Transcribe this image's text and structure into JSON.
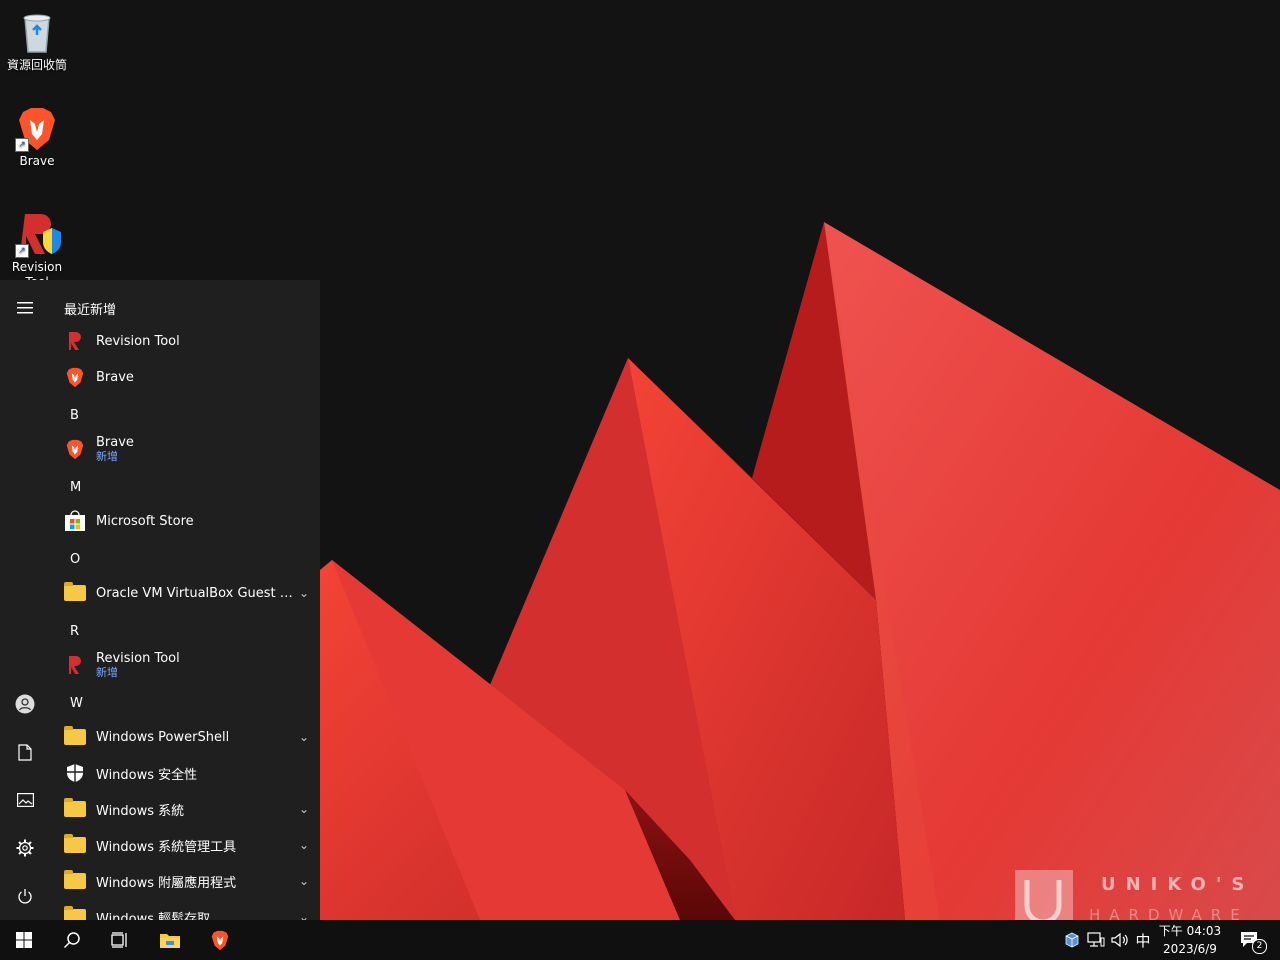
{
  "desktop": {
    "icons": [
      {
        "label": "資源回收筒",
        "icon": "recycle-bin-icon"
      },
      {
        "label": "Brave",
        "icon": "brave-lion-icon"
      },
      {
        "label": "Revision Tool",
        "icon": "revision-tool-icon"
      }
    ]
  },
  "start_menu": {
    "header": "最近新增",
    "recent": [
      {
        "label": "Revision Tool",
        "icon": "revision-tool-icon"
      },
      {
        "label": "Brave",
        "icon": "brave-lion-icon"
      }
    ],
    "groups": {
      "b": "B",
      "m": "M",
      "o": "O",
      "r": "R",
      "w": "W"
    },
    "apps": {
      "brave": {
        "label": "Brave",
        "badge": "新增"
      },
      "store": {
        "label": "Microsoft Store"
      },
      "vbox": {
        "label": "Oracle VM VirtualBox Guest Ad..."
      },
      "revision": {
        "label": "Revision Tool",
        "badge": "新增"
      },
      "powershell": {
        "label": "Windows PowerShell"
      },
      "security": {
        "label": "Windows 安全性"
      },
      "system": {
        "label": "Windows 系統"
      },
      "admin": {
        "label": "Windows 系統管理工具"
      },
      "accessories": {
        "label": "Windows 附屬應用程式"
      },
      "ease": {
        "label": "Windows 輕鬆存取"
      }
    },
    "rail": [
      "hamburger-menu-icon",
      "user-icon",
      "document-icon",
      "pictures-icon",
      "settings-gear-icon",
      "power-icon"
    ]
  },
  "taskbar": {
    "buttons": [
      "windows-start-icon",
      "search-icon",
      "task-view-icon",
      "file-explorer-icon",
      "brave-lion-icon"
    ],
    "tray": {
      "ime": "中",
      "time": "下午 04:03",
      "date": "2023/6/9",
      "notification_count": "2"
    }
  },
  "watermark": {
    "line1": "UNIKO'S",
    "line2": "HARDWARE"
  },
  "colors": {
    "accent": "#e53935",
    "menu_bg": "#1f1f1f",
    "taskbar_bg": "#101010",
    "badge_blue": "#79a6ff"
  }
}
